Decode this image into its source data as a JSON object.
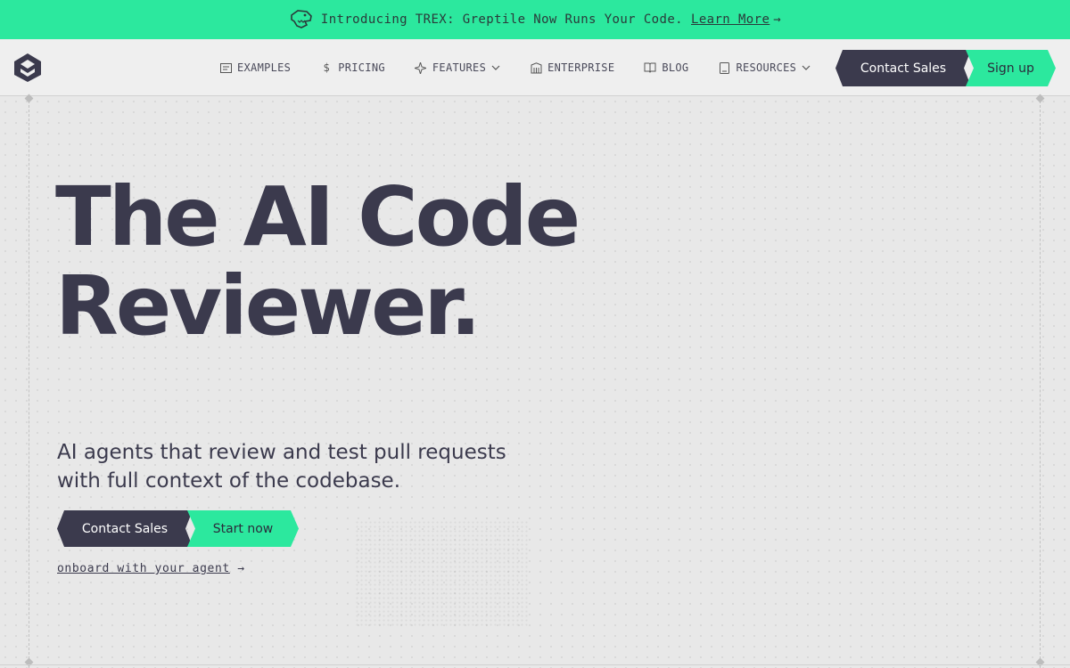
{
  "announcement": {
    "text": "Introducing TREX: Greptile Now Runs Your Code.",
    "link_label": "Learn More",
    "arrow": "→",
    "icon": "trex-icon"
  },
  "nav": {
    "logo": "greptile-logo",
    "links": [
      {
        "label": "EXAMPLES",
        "icon": "examples-icon"
      },
      {
        "label": "PRICING",
        "icon": "dollar-icon"
      },
      {
        "label": "FEATURES",
        "icon": "sparkle-icon",
        "dropdown": true
      },
      {
        "label": "ENTERPRISE",
        "icon": "building-icon"
      },
      {
        "label": "BLOG",
        "icon": "book-icon"
      },
      {
        "label": "RESOURCES",
        "icon": "document-icon",
        "dropdown": true
      }
    ],
    "contact_sales": "Contact Sales",
    "sign_up": "Sign up"
  },
  "hero": {
    "headline_line1": "The AI Code",
    "headline_line2": "Reviewer.",
    "subtext_line1": "AI agents that review and test pull requests",
    "subtext_line2": "with full context of the codebase.",
    "contact_sales": "Contact Sales",
    "start_now": "Start now",
    "onboard_link": "onboard with your agent",
    "onboard_arrow": "→"
  },
  "colors": {
    "accent_green": "#2ce89e",
    "dark": "#3b3a4d",
    "background": "#e8e8e8"
  }
}
